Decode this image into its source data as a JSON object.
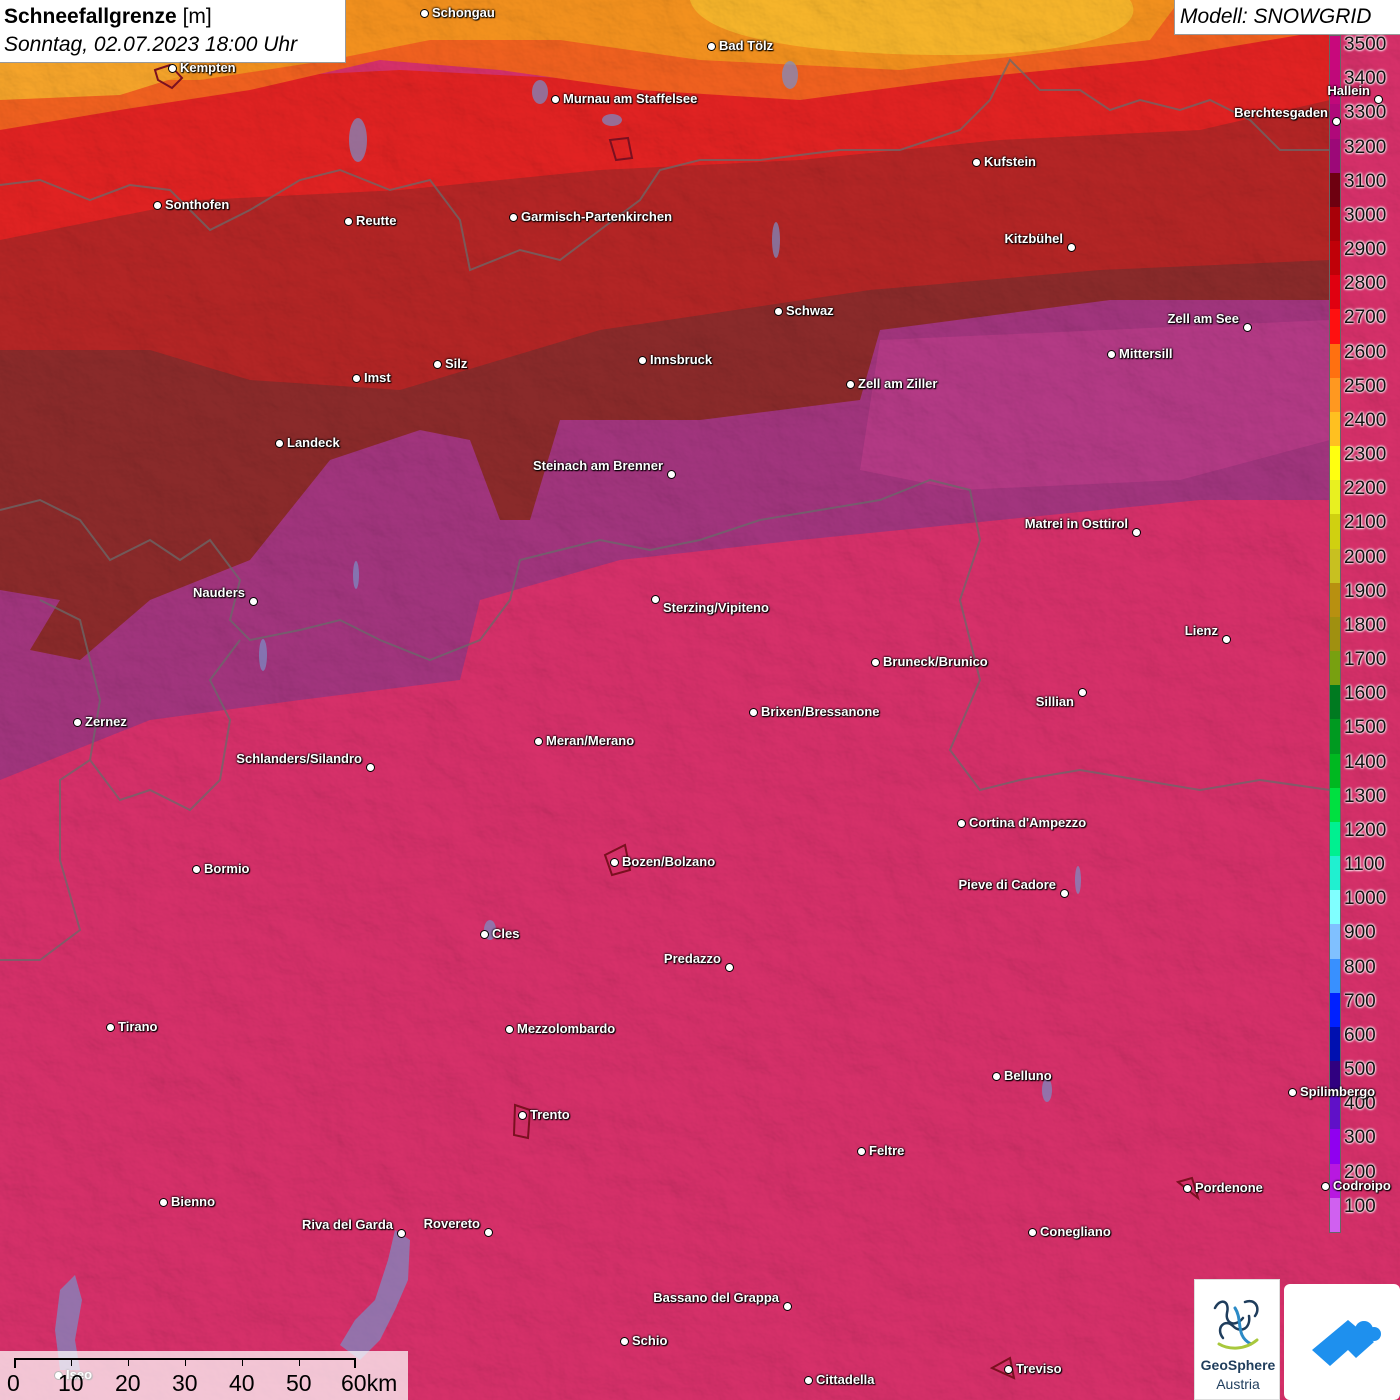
{
  "header": {
    "title_bold": "Schneefallgrenze",
    "title_unit": "[m]",
    "subtitle": "Sonntag, 02.07.2023 18:00 Uhr",
    "model": "Modell: SNOWGRID"
  },
  "legend": {
    "levels": [
      {
        "label": "3500",
        "color": "#c8087c"
      },
      {
        "label": "3400",
        "color": "#c0087a"
      },
      {
        "label": "3300",
        "color": "#b0087a"
      },
      {
        "label": "3200",
        "color": "#9c0878"
      },
      {
        "label": "3100",
        "color": "#6e0010"
      },
      {
        "label": "3000",
        "color": "#a80008"
      },
      {
        "label": "2900",
        "color": "#c00008"
      },
      {
        "label": "2800",
        "color": "#e00010"
      },
      {
        "label": "2700",
        "color": "#ff1010"
      },
      {
        "label": "2600",
        "color": "#ff7010"
      },
      {
        "label": "2500",
        "color": "#ff9820"
      },
      {
        "label": "2400",
        "color": "#ffc020"
      },
      {
        "label": "2300",
        "color": "#ffff10"
      },
      {
        "label": "2200",
        "color": "#e8f020"
      },
      {
        "label": "2100",
        "color": "#d0d010"
      },
      {
        "label": "2000",
        "color": "#c8c020"
      },
      {
        "label": "1900",
        "color": "#b89010"
      },
      {
        "label": "1800",
        "color": "#a09010"
      },
      {
        "label": "1700",
        "color": "#78a010"
      },
      {
        "label": "1600",
        "color": "#007a20"
      },
      {
        "label": "1500",
        "color": "#009a20"
      },
      {
        "label": "1400",
        "color": "#00b820"
      },
      {
        "label": "1300",
        "color": "#00e040"
      },
      {
        "label": "1200",
        "color": "#00f090"
      },
      {
        "label": "1100",
        "color": "#20f0d0"
      },
      {
        "label": "1000",
        "color": "#80ffff"
      },
      {
        "label": "900",
        "color": "#80c0ff"
      },
      {
        "label": "800",
        "color": "#3890ff"
      },
      {
        "label": "700",
        "color": "#0020ff"
      },
      {
        "label": "600",
        "color": "#0010b0"
      },
      {
        "label": "500",
        "color": "#300080"
      },
      {
        "label": "400",
        "color": "#6010c8"
      },
      {
        "label": "300",
        "color": "#9000f0"
      },
      {
        "label": "200",
        "color": "#b818e0"
      },
      {
        "label": "100",
        "color": "#d060f0"
      }
    ]
  },
  "cities": [
    {
      "name": "Schongau"
    },
    {
      "name": "Bad Tölz"
    },
    {
      "name": "Kempten"
    },
    {
      "name": "Murnau am Staffelsee"
    },
    {
      "name": "Hallein"
    },
    {
      "name": "Berchtesgaden"
    },
    {
      "name": "Kufstein"
    },
    {
      "name": "Sonthofen"
    },
    {
      "name": "Reutte"
    },
    {
      "name": "Garmisch-Partenkirchen"
    },
    {
      "name": "Kitzbühel"
    },
    {
      "name": "Schwaz"
    },
    {
      "name": "Zell am See"
    },
    {
      "name": "Innsbruck"
    },
    {
      "name": "Mittersill"
    },
    {
      "name": "Imst"
    },
    {
      "name": "Silz"
    },
    {
      "name": "Zell am Ziller"
    },
    {
      "name": "Landeck"
    },
    {
      "name": "Steinach am Brenner"
    },
    {
      "name": "Matrei in Osttirol"
    },
    {
      "name": "Nauders"
    },
    {
      "name": "Sterzing/Vipiteno"
    },
    {
      "name": "Lienz"
    },
    {
      "name": "Bruneck/Brunico"
    },
    {
      "name": "Sillian"
    },
    {
      "name": "Brixen/Bressanone"
    },
    {
      "name": "Zernez"
    },
    {
      "name": "Meran/Merano"
    },
    {
      "name": "Schlanders/Silandro"
    },
    {
      "name": "Cortina d'Ampezzo"
    },
    {
      "name": "Bozen/Bolzano"
    },
    {
      "name": "Bormio"
    },
    {
      "name": "Pieve di Cadore"
    },
    {
      "name": "Cles"
    },
    {
      "name": "Predazzo"
    },
    {
      "name": "Tirano"
    },
    {
      "name": "Mezzolombardo"
    },
    {
      "name": "Belluno"
    },
    {
      "name": "Spilimbergo"
    },
    {
      "name": "Trento"
    },
    {
      "name": "Feltre"
    },
    {
      "name": "Pordenone"
    },
    {
      "name": "Codroipo"
    },
    {
      "name": "Bienno"
    },
    {
      "name": "Riva del Garda"
    },
    {
      "name": "Rovereto"
    },
    {
      "name": "Conegliano"
    },
    {
      "name": "Bassano del Grappa"
    },
    {
      "name": "Schio"
    },
    {
      "name": "Iseo"
    },
    {
      "name": "Treviso"
    },
    {
      "name": "Cittadella"
    }
  ],
  "scale_bar": {
    "labels": [
      "0",
      "10",
      "20",
      "30",
      "40",
      "50",
      "60km"
    ]
  },
  "logos": {
    "geosphere_line1": "GeoSphere",
    "geosphere_line2": "Austria"
  }
}
